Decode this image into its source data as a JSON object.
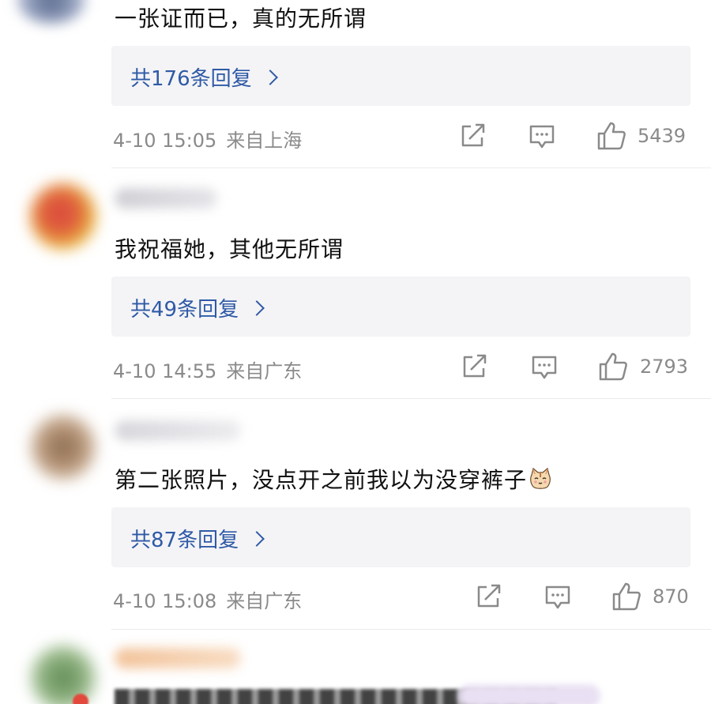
{
  "comments": [
    {
      "text": "一张证而已，真的无所谓",
      "reply_label": "共176条回复",
      "date": "4-10 15:05",
      "location": "来自上海",
      "likes": "5439"
    },
    {
      "text": "我祝福她，其他无所谓",
      "reply_label": "共49条回复",
      "date": "4-10 14:55",
      "location": "来自广东",
      "likes": "2793"
    },
    {
      "text": "第二张照片，没点开之前我以为没穿裤子",
      "emoji": "cat-face-emoji",
      "reply_label": "共87条回复",
      "date": "4-10 15:08",
      "location": "来自广东",
      "likes": "870"
    }
  ],
  "icons": {
    "share": "share-icon",
    "comment": "comment-icon",
    "like": "thumbs-up-icon",
    "chevron": "chevron-right-icon"
  },
  "colors": {
    "reply_link": "#2f5aa6",
    "reply_box_bg": "#f4f4f6",
    "meta_text": "#8a8a8a",
    "body_text": "#111111"
  }
}
